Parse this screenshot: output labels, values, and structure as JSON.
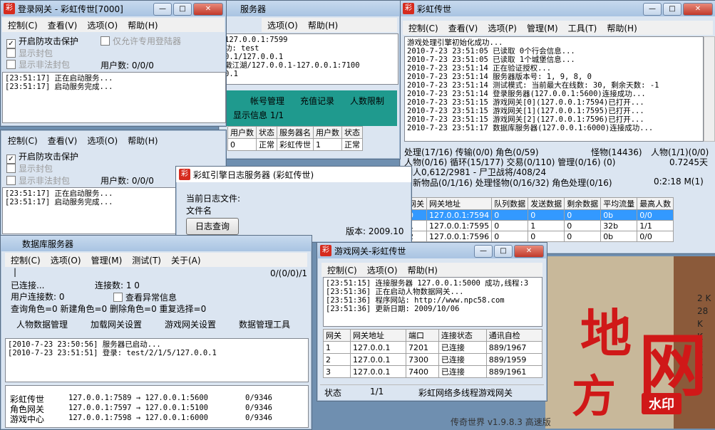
{
  "login1": {
    "title": "登录网关 - 彩虹传世[7000]",
    "menu": [
      "控制(C)",
      "查看(V)",
      "选项(O)",
      "帮助(H)"
    ],
    "opt1": "开启防攻击保护",
    "opt2": "仅允许专用登陆器",
    "opt3": "显示封包",
    "opt4": "显示非法封包",
    "users": "用户数: 0/0/0",
    "log": "[23:51:17] 正在启动服务...\n[23:51:17] 启动服务完成..."
  },
  "login2": {
    "menu": [
      "控制(C)",
      "查看(V)",
      "选项(O)",
      "帮助(H)"
    ],
    "opt1": "开启防攻击保护",
    "opt3": "显示封包",
    "opt4": "显示非法封包",
    "users": "用户数: 0/0/0",
    "log": "[23:51:17] 正在启动服务...\n[23:51:17] 启动服务完成..."
  },
  "account": {
    "title": "服务器",
    "menu": [
      "选项(O)",
      "帮助(H)"
    ],
    "log": "127.0.0.1:7599\n功: test\n0.1/127.0.0.1\n徽江湖/127.0.0.1-127.0.0.1:7100\n0.1",
    "tabs": [
      "帐号管理",
      "充值记录",
      "人数限制"
    ],
    "show": "显示信息  1/1",
    "cols": [
      "用户数",
      "状态",
      "服务器名",
      "用户数",
      "状态"
    ],
    "row": [
      "0",
      "正常",
      "彩虹传世",
      "1",
      "正常"
    ]
  },
  "engine": {
    "title": "彩虹传世",
    "menu": [
      "控制(C)",
      "查看(V)",
      "选项(P)",
      "管理(M)",
      "工具(T)",
      "帮助(H)"
    ],
    "log": "游戏处理引擎初始化成功...\n2010-7-23 23:51:05 已读取 0个行会信息...\n2010-7-23 23:51:05 已读取 1个城堡信息...\n2010-7-23 23:51:14 正在验证授权...\n2010-7-23 23:51:14 服务器版本号: 1, 9, 8, 0\n2010-7-23 23:51:14 测试模式: 当前最大在线数: 30, 剩余天数: -1\n2010-7-23 23:51:14 登录服务器(127.0.0.1:5600)连接成功...\n2010-7-23 23:51:15 游戏网关[0](127.0.0.1:7594)已打开...\n2010-7-23 23:51:15 游戏网关[1](127.0.0.1:7595)已打开...\n2010-7-23 23:51:15 游戏网关[2](127.0.0.1:7596)已打开...\n2010-7-23 23:51:17 数据库服务器(127.0.0.1:6000)连接成功...",
    "s1": "处理(17/16) 传输(0/0) 角色(0/59)",
    "s1b": "怪物(14436)",
    "s1c": "人物(1/1)(0/0)",
    "s2": "人物(0/16) 循环(15/177) 交易(0/110) 管理(0/16) (0)",
    "s2b": "0.7245天",
    "s3": "铜人0,612/2981 - 尸卫战将/408/24",
    "s4": "刷新物品(0/1/16) 处理怪物(0/16/32) 角色处理(0/16)",
    "s4b": "0:2:18 M(1)",
    "cols": [
      "网关",
      "网关地址",
      "队列数据",
      "发送数据",
      "剩余数据",
      "平均流量",
      "最高人数"
    ],
    "rows": [
      [
        "0",
        "127.0.0.1:7594",
        "0",
        "0",
        "0",
        "0b",
        "0/0"
      ],
      [
        "1",
        "127.0.0.1:7595",
        "0",
        "1",
        "0",
        "32b",
        "1/1"
      ],
      [
        "2",
        "127.0.0.1:7596",
        "0",
        "0",
        "0",
        "0b",
        "0/0"
      ]
    ]
  },
  "logsrv": {
    "title": "彩虹引擎日志服务器 (彩虹传世)",
    "l1": "当前日志文件:",
    "l2": "文件名",
    "btn": "日志查询",
    "ver": "版本: 2009.10"
  },
  "db": {
    "title": "数据库服务器",
    "menu": [
      "控制(C)",
      "选项(O)",
      "管理(M)",
      "测试(T)",
      "关于(A)"
    ],
    "cursor": "|",
    "ratio": "0/(0/0)/1",
    "conn": "已连接...",
    "conncount": "连接数: 1     0",
    "users": "用户连接数:    0",
    "abn": "查看异常信息",
    "q": "查询角色=0  新建角色=0  删除角色=0  重复选择=0",
    "btns": [
      "人物数据管理",
      "加载网关设置",
      "游戏网关设置",
      "数据管理工具"
    ],
    "log": "[2010-7-23 23:50:56] 服务器已启动...\n[2010-7-23 23:51:51] 登录: test/2/1/5/127.0.0.1",
    "routes": [
      [
        "彩虹传世",
        "127.0.0.1:7589 → 127.0.0.1:5600",
        "0/9346"
      ],
      [
        "角色网关",
        "127.0.0.1:7597 → 127.0.0.1:5100",
        "0/9346"
      ],
      [
        "游戏中心",
        "127.0.0.1:7598 → 127.0.0.1:6000",
        "0/9346"
      ]
    ]
  },
  "gate": {
    "title": "游戏网关-彩虹传世",
    "menu": [
      "控制(C)",
      "选项(O)",
      "帮助(H)"
    ],
    "log": "[23:51:15] 连接服务器 127.0.0.1:5000 成功,线程:3\n[23:51:36] 正在启动人物数据网关...\n[23:51:36] 程序网站: http://www.npc58.com\n[23:51:36] 更新日期: 2009/10/06",
    "cols": [
      "网关",
      "网关地址",
      "端口",
      "连接状态",
      "通讯自检"
    ],
    "rows": [
      [
        "1",
        "127.0.0.1",
        "7201",
        "已连接",
        "889/1967"
      ],
      [
        "2",
        "127.0.0.1",
        "7300",
        "已连接",
        "889/1959"
      ],
      [
        "3",
        "127.0.0.1",
        "7400",
        "已连接",
        "889/1961"
      ]
    ],
    "st1": "状态",
    "st2": "1/1",
    "st3": "彩虹网络多线程游戏网关"
  },
  "watermark": {
    "line1": "地方",
    "line2": "网",
    "tag": "水印"
  },
  "bg": {
    "right": [
      "2 K",
      "28 K",
      "K",
      "K",
      "K",
      "K"
    ],
    "bottom": "传奇世界 v1.9.8.3 高速版"
  }
}
